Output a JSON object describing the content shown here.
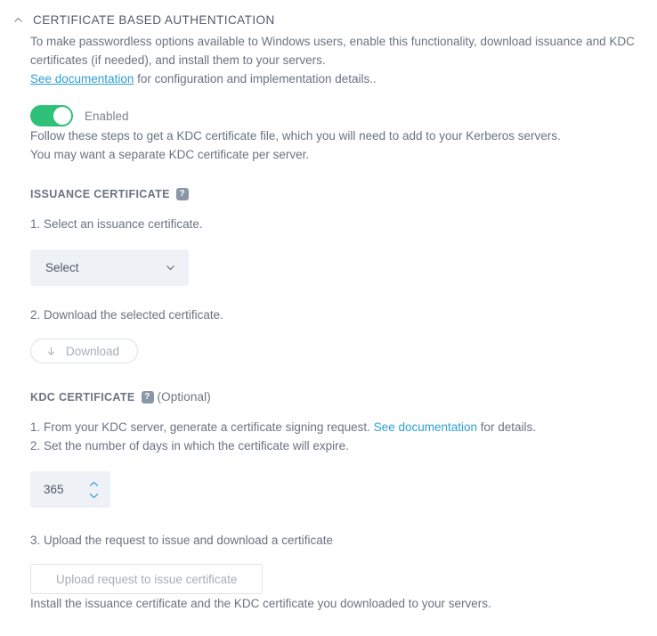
{
  "section": {
    "title": "CERTIFICATE BASED AUTHENTICATION",
    "collapse_icon": "chevron-up-icon"
  },
  "intro": {
    "text": "To make passwordless options available to Windows users, enable this functionality, download issuance and KDC certificates (if needed), and install them to your servers."
  },
  "doc_line": {
    "link_label": "See documentation",
    "rest": " for configuration and implementation details.."
  },
  "toggle": {
    "label": "Enabled",
    "state": "on",
    "on_color": "#2ec177",
    "knob_color": "#ffffff"
  },
  "follow_steps": {
    "line1": "Follow these steps to get a KDC certificate file, which you will need to add to your Kerberos servers.",
    "line2": "You may want a separate KDC certificate per server."
  },
  "issuance": {
    "heading": "ISSUANCE CERTIFICATE",
    "help_icon": "help-question-icon",
    "step1": "1. Select an issuance certificate.",
    "select": {
      "value": "Select",
      "chevron": "chevron-down-icon",
      "background": "#eef2f6"
    },
    "step2": "2. Download the selected certificate.",
    "download_button": {
      "label": "Download",
      "icon": "download-arrow-icon",
      "disabled": true
    }
  },
  "kdc": {
    "heading": "KDC CERTIFICATE",
    "help_icon": "help-question-icon",
    "optional_label": "(Optional)",
    "step1_before": "1. From your KDC server, generate a certificate signing request. ",
    "step1_link": "See documentation",
    "step1_after": " for details.",
    "step2": "2. Set the number of days in which the certificate will expire.",
    "days": {
      "value": "365",
      "up_icon": "chevron-up-icon",
      "down_icon": "chevron-down-icon",
      "background": "#eef2f6"
    },
    "step3": "3. Upload the request to issue and download a certificate",
    "upload_button": {
      "label": "Upload request to issue certificate",
      "disabled": true
    }
  },
  "footer": {
    "text": "Install the issuance certificate and the KDC certificate you downloaded to your servers."
  },
  "colors": {
    "link": "#2e9fd4",
    "text": "#6a7381",
    "heading": "#50596c",
    "toggle_on": "#2ec177",
    "field_bg": "#eef2f6",
    "stepper_arrow": "#3f9fd0"
  }
}
